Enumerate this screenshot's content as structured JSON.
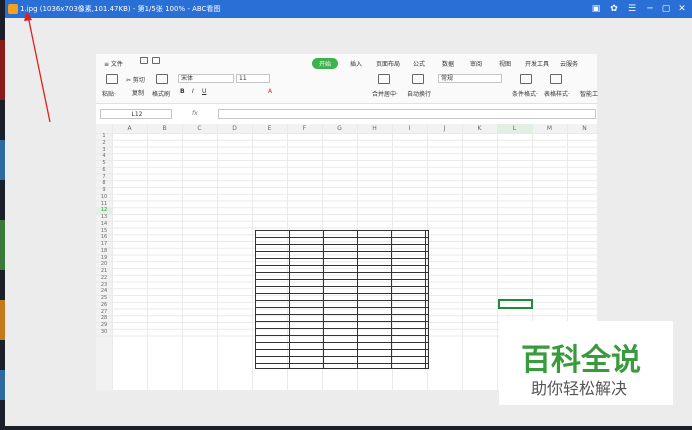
{
  "window": {
    "title": "1.jpg (1036x703像素,101.47KB) - 第1/5张 100% - ABC看图",
    "controls": [
      "▣",
      "✿",
      "☰",
      "─",
      "▢",
      "✕"
    ]
  },
  "ribbon": {
    "file_menu": "≡ 文件",
    "tabs": [
      "开始",
      "插入",
      "页面布局",
      "公式",
      "数据",
      "审阅",
      "视图",
      "开发工具",
      "云服务"
    ],
    "paste": "粘贴·",
    "cut": "✂ 剪切",
    "copy": "复制",
    "format_painter": "格式刷",
    "font": "宋体",
    "font_size": "11",
    "number_format": "常规",
    "merge_center": "合并居中·",
    "wrap_text": "自动换行",
    "cond_format": "条件格式·",
    "table_style": "表格样式·",
    "smart_tool": "智能工"
  },
  "formula_bar": {
    "cell_ref": "L12",
    "fx": "fx"
  },
  "columns": [
    "A",
    "B",
    "C",
    "D",
    "E",
    "F",
    "G",
    "H",
    "I",
    "J",
    "K",
    "L",
    "M",
    "N"
  ],
  "rows": [
    "1",
    "2",
    "3",
    "4",
    "5",
    "6",
    "7",
    "8",
    "9",
    "10",
    "11",
    "12",
    "13",
    "14",
    "15",
    "16",
    "17",
    "18",
    "19",
    "20",
    "21",
    "22",
    "23",
    "24",
    "25",
    "26",
    "27",
    "28",
    "29",
    "30"
  ],
  "selected": {
    "column": "L",
    "row": "12"
  },
  "watermark": {
    "title": "百科全说",
    "subtitle": "助你轻松解决"
  }
}
